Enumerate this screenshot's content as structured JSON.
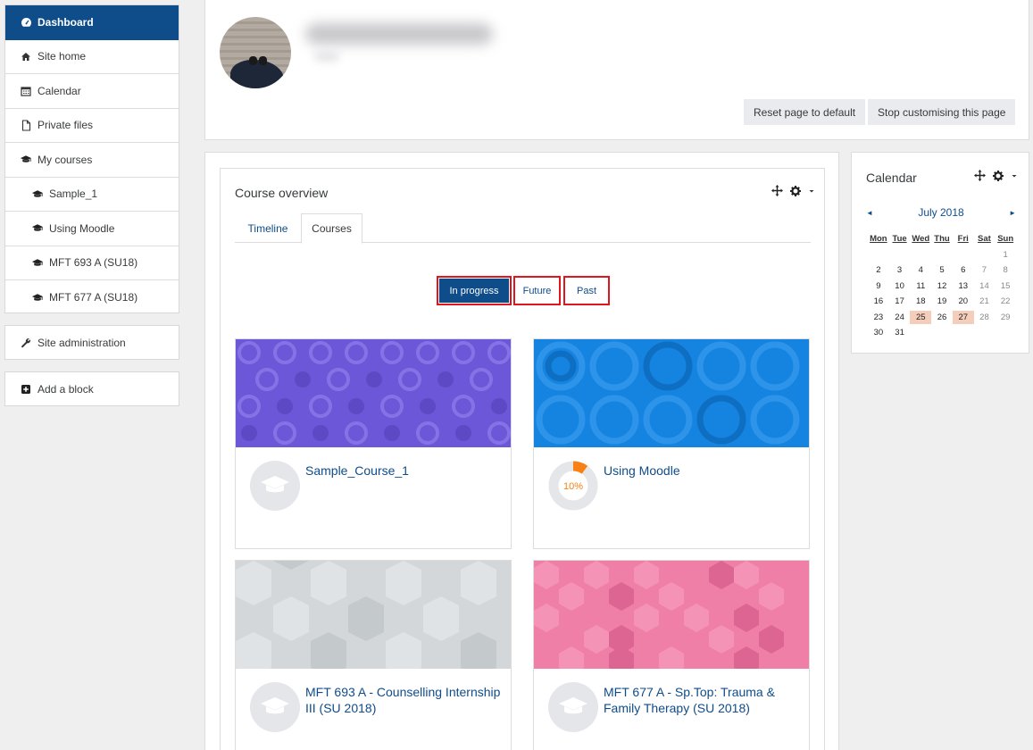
{
  "sidebar": {
    "items": [
      {
        "label": "Dashboard",
        "icon": "dashboard-icon"
      },
      {
        "label": "Site home",
        "icon": "home-icon"
      },
      {
        "label": "Calendar",
        "icon": "calendar-icon"
      },
      {
        "label": "Private files",
        "icon": "file-icon"
      },
      {
        "label": "My courses",
        "icon": "graduation-cap-icon"
      },
      {
        "label": "Sample_1",
        "icon": "graduation-cap-icon"
      },
      {
        "label": "Using Moodle",
        "icon": "graduation-cap-icon"
      },
      {
        "label": "MFT 693 A (SU18)",
        "icon": "graduation-cap-icon"
      },
      {
        "label": "MFT 677 A (SU18)",
        "icon": "graduation-cap-icon"
      }
    ],
    "site_admin": {
      "label": "Site administration",
      "icon": "wrench-icon"
    },
    "add_block": {
      "label": "Add a block",
      "icon": "plus-square-icon"
    }
  },
  "header": {
    "reset_label": "Reset page to default",
    "stop_label": "Stop customising this page"
  },
  "overview": {
    "title": "Course overview",
    "tabs": [
      {
        "label": "Timeline"
      },
      {
        "label": "Courses"
      }
    ],
    "active_tab": "Courses",
    "filters": [
      {
        "label": "In progress"
      },
      {
        "label": "Future"
      },
      {
        "label": "Past"
      }
    ],
    "active_filter": "In progress",
    "courses": [
      {
        "name": "Sample_Course_1",
        "image_color": "#6c57d8",
        "pattern": "circles"
      },
      {
        "name": "Using Moodle",
        "image_color": "#1584e1",
        "pattern": "rings",
        "progress_label": "10%",
        "progress": 0.1
      },
      {
        "name": "MFT 693 A - Counselling Internship III (SU 2018)",
        "image_color": "#d3d7da",
        "pattern": "hexagons"
      },
      {
        "name": "MFT 677 A - Sp.Top: Trauma & Family Therapy (SU 2018)",
        "image_color": "#f07fa8",
        "pattern": "hexagons"
      }
    ]
  },
  "calendar": {
    "title": "Calendar",
    "month": "July 2018",
    "prev": "◄",
    "next": "►",
    "weekdays": [
      "Mon",
      "Tue",
      "Wed",
      "Thu",
      "Fri",
      "Sat",
      "Sun"
    ],
    "weeks": [
      [
        "",
        "",
        "",
        "",
        "",
        "",
        "1"
      ],
      [
        "2",
        "3",
        "4",
        "5",
        "6",
        "7",
        "8"
      ],
      [
        "9",
        "10",
        "11",
        "12",
        "13",
        "14",
        "15"
      ],
      [
        "16",
        "17",
        "18",
        "19",
        "20",
        "21",
        "22"
      ],
      [
        "23",
        "24",
        "25",
        "26",
        "27",
        "28",
        "29"
      ],
      [
        "30",
        "31",
        "",
        "",
        "",
        "",
        ""
      ]
    ],
    "event_days": [
      "25",
      "27"
    ]
  },
  "colors": {
    "primary": "#0f4c8a",
    "highlight_border": "#e0161e",
    "progress": "#f98012",
    "event_day": "#f5cdbb"
  }
}
